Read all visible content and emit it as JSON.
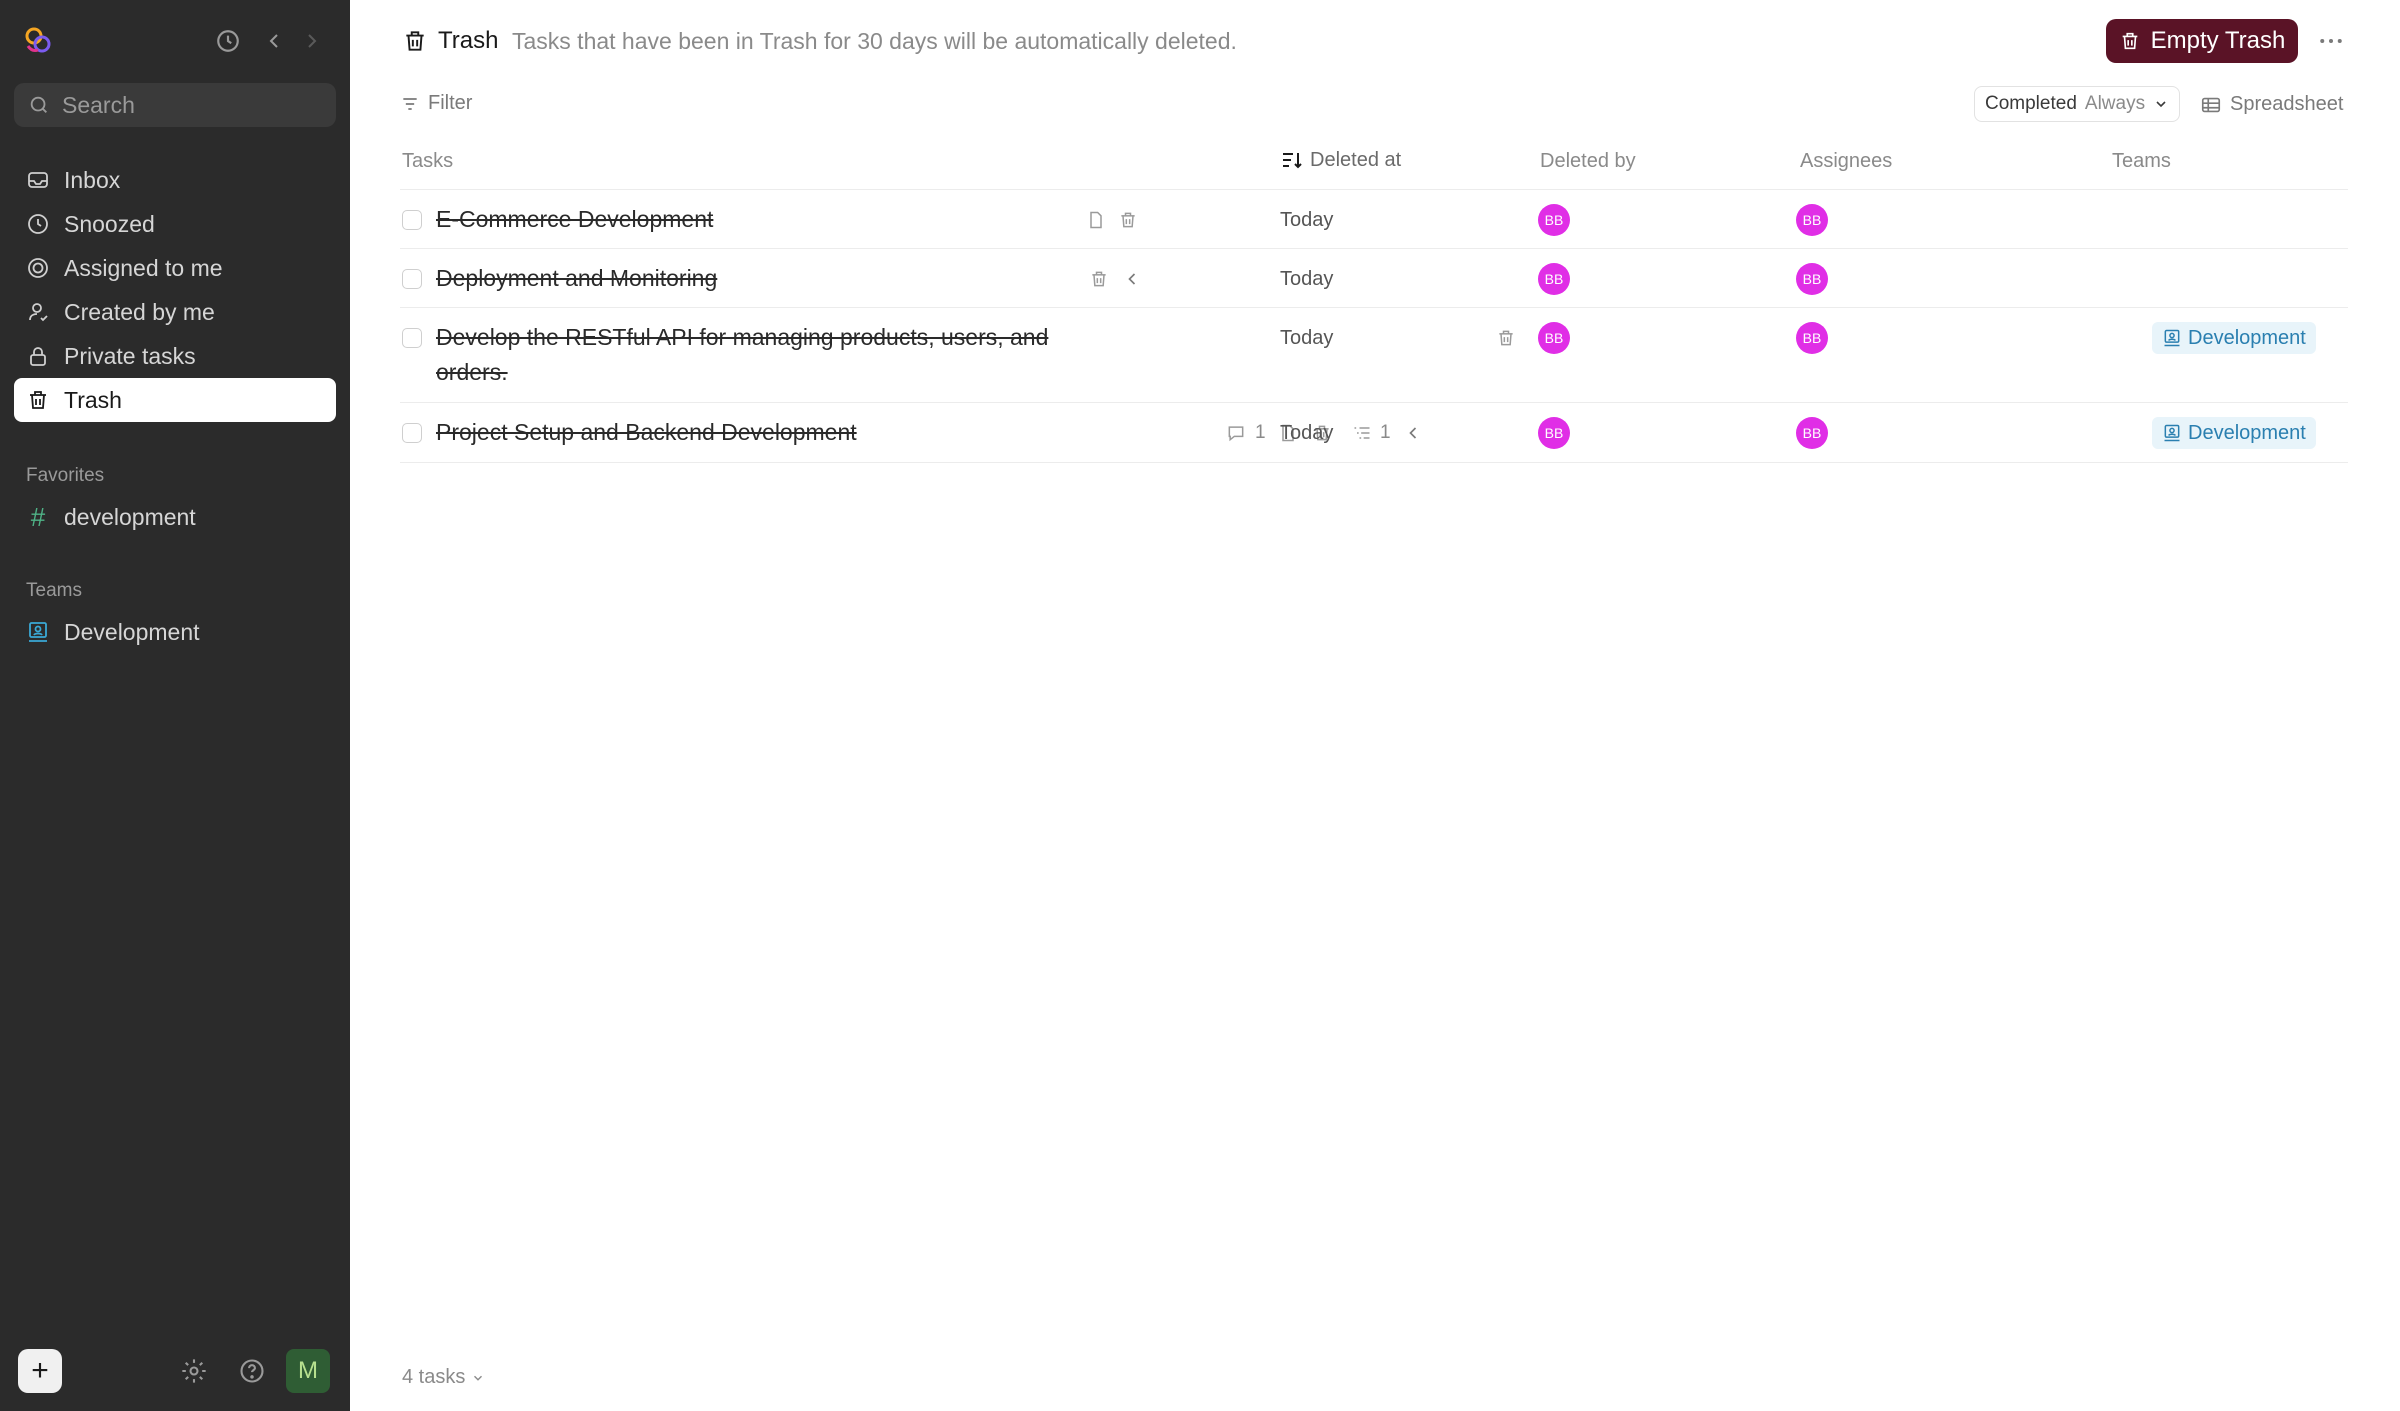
{
  "sidebar": {
    "search_placeholder": "Search",
    "nav": [
      {
        "label": "Inbox",
        "icon": "inbox-icon"
      },
      {
        "label": "Snoozed",
        "icon": "clock-icon"
      },
      {
        "label": "Assigned to me",
        "icon": "target-icon"
      },
      {
        "label": "Created by me",
        "icon": "user-icon"
      },
      {
        "label": "Private tasks",
        "icon": "lock-icon"
      },
      {
        "label": "Trash",
        "icon": "trash-icon"
      }
    ],
    "favorites_label": "Favorites",
    "favorites": [
      {
        "label": "development",
        "icon": "hash-icon"
      }
    ],
    "teams_label": "Teams",
    "teams": [
      {
        "label": "Development",
        "icon": "team-icon"
      }
    ],
    "user_initial": "M",
    "add_label": "+"
  },
  "header": {
    "title": "Trash",
    "subtitle": "Tasks that have been in Trash for 30 days will be automatically deleted.",
    "empty_button": "Empty Trash"
  },
  "toolbar": {
    "filter_label": "Filter",
    "completed_key": "Completed",
    "completed_value": "Always",
    "view_label": "Spreadsheet"
  },
  "table": {
    "columns": [
      "Tasks",
      "Deleted at",
      "Deleted by",
      "Assignees",
      "Teams"
    ],
    "rows": [
      {
        "task": "E-Commerce Development",
        "deleted_at": "Today",
        "deleted_by": "BB",
        "assignee": "BB",
        "team": ""
      },
      {
        "task": "Deployment and Monitoring",
        "deleted_at": "Today",
        "deleted_by": "BB",
        "assignee": "BB",
        "team": ""
      },
      {
        "task_line1": "Develop the RESTful API for managing products, users, and",
        "task_line2": "orders.",
        "deleted_at": "Today",
        "deleted_by": "BB",
        "assignee": "BB",
        "team": "Development"
      },
      {
        "task": "Project Setup and Backend Development",
        "comments": "1",
        "subtasks": "1",
        "deleted_at": "Today",
        "deleted_by": "BB",
        "assignee": "BB",
        "team": "Development"
      }
    ]
  },
  "footer": {
    "count_label": "4 tasks"
  },
  "colors": {
    "sidebar_bg": "#2b2b2b",
    "empty_button_bg": "#5a1326",
    "avatar_bg": "#e02ee6",
    "team_pill_bg": "#e8f4fa",
    "team_pill_text": "#2a7fb0"
  }
}
